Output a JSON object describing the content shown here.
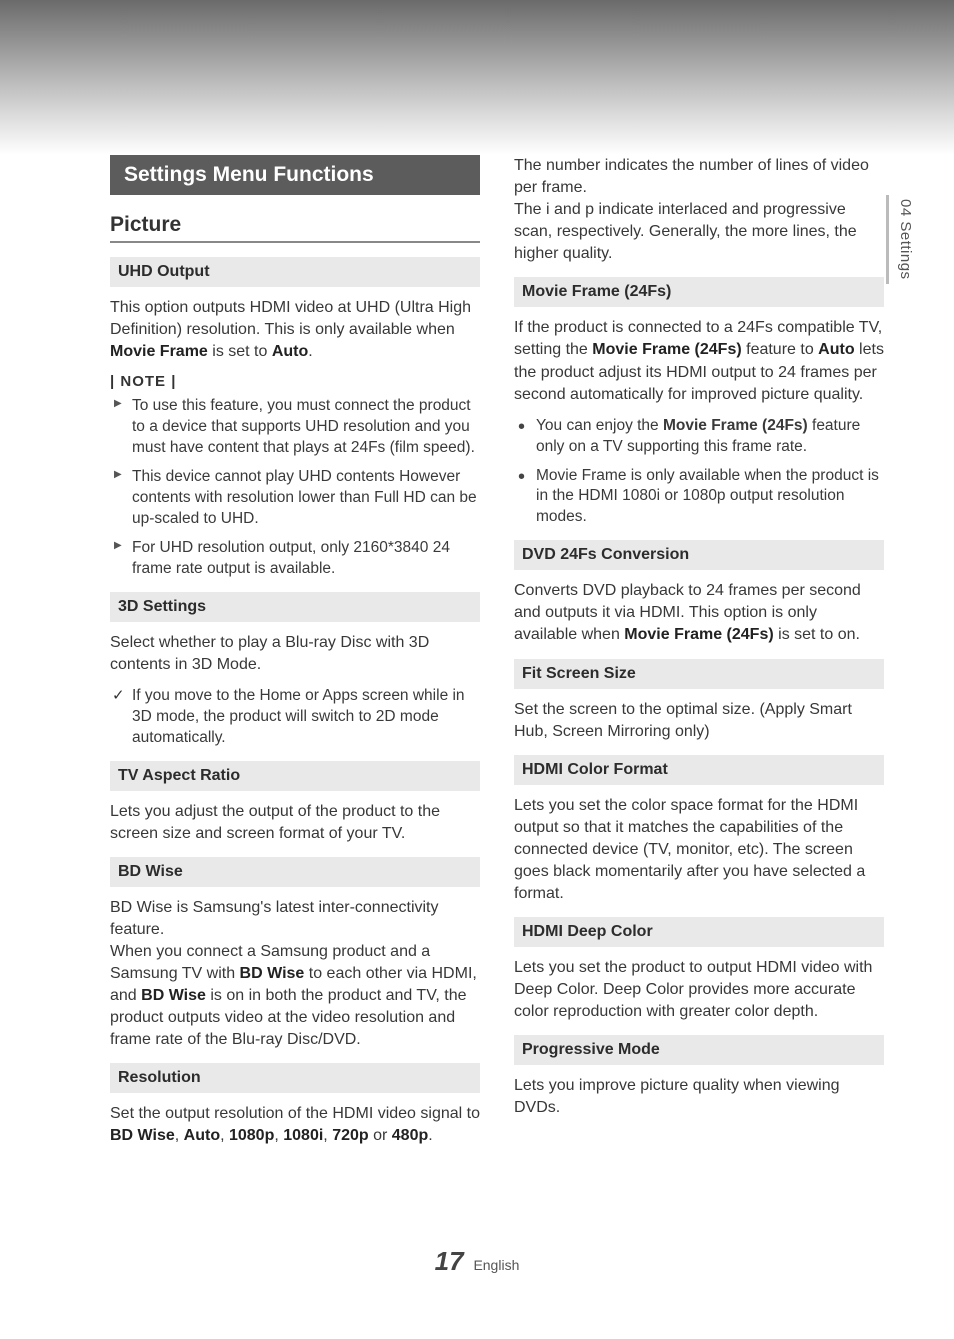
{
  "sideTab": "04  Settings",
  "chapterTitle": "Settings Menu Functions",
  "sectionTitle": "Picture",
  "noteLabel": "| NOTE |",
  "left": {
    "uhd": {
      "head": "UHD Output",
      "p1a": "This option outputs HDMI video at UHD (Ultra High Definition) resolution. This is only available when ",
      "p1b": "Movie Frame",
      "p1c": " is set to ",
      "p1d": "Auto",
      "p1e": ".",
      "n1": "To use this feature, you must connect the product to a device that supports UHD resolution and you must have content that plays at 24Fs (film speed).",
      "n2": "This device cannot play UHD contents However contents with resolution lower than Full HD can be up-scaled to UHD.",
      "n3": "For UHD resolution output, only 2160*3840 24 frame rate output is available."
    },
    "threeD": {
      "head": "3D Settings",
      "p1": "Select whether to play a Blu-ray Disc with 3D contents in 3D Mode.",
      "c1": "If you move to the Home or Apps screen while in 3D mode, the product will switch to 2D mode automatically."
    },
    "aspect": {
      "head": "TV Aspect Ratio",
      "p1": "Lets you adjust the output of the product to the screen size and screen format of your TV."
    },
    "bdwise": {
      "head": "BD Wise",
      "p1a": "BD Wise is Samsung's latest inter-connectivity feature.",
      "p1b": "When you connect a Samsung product and a Samsung TV with ",
      "p1c": "BD Wise",
      "p1d": " to each other via HDMI, and ",
      "p1e": "BD Wise",
      "p1f": " is on in both the product and TV, the product outputs video at the video resolution and frame rate of the Blu-ray Disc/DVD."
    },
    "resolution": {
      "head": "Resolution",
      "p1a": "Set the output resolution of the HDMI video signal to ",
      "b1": "BD Wise",
      "s1": ", ",
      "b2": "Auto",
      "s2": ", ",
      "b3": "1080p",
      "s3": ", ",
      "b4": "1080i",
      "s4": ", ",
      "b5": "720p",
      "s5": " or ",
      "b6": "480p",
      "s6": "."
    }
  },
  "right": {
    "resCont": "The number indicates the number of lines of video per frame.\nThe i and p indicate interlaced and progressive scan, respectively. Generally, the more lines, the higher quality.",
    "movieFrame": {
      "head": "Movie Frame (24Fs)",
      "p1a": "If the product is connected to a 24Fs compatible TV, setting the ",
      "p1b": "Movie Frame (24Fs)",
      "p1c": " feature to ",
      "p1d": "Auto",
      "p1e": " lets the product adjust its HDMI output to 24 frames per second automatically for improved picture quality.",
      "l1a": "You can enjoy the ",
      "l1b": "Movie Frame (24Fs)",
      "l1c": " feature only on a TV supporting this frame rate.",
      "l2": "Movie Frame is only available when the product is in the HDMI 1080i or 1080p output resolution modes."
    },
    "dvd24": {
      "head": "DVD 24Fs Conversion",
      "p1a": "Converts DVD playback to 24 frames per second and outputs it via HDMI. This option is only available when ",
      "p1b": "Movie Frame (24Fs)",
      "p1c": " is set to on."
    },
    "fit": {
      "head": "Fit Screen Size",
      "p1": "Set the screen to the optimal size. (Apply Smart Hub, Screen Mirroring only)"
    },
    "hdmiColor": {
      "head": "HDMI Color Format",
      "p1": "Lets you set the color space format for the HDMI output so that it matches the capabilities of the connected device (TV, monitor, etc). The screen goes black momentarily after you have selected a format."
    },
    "hdmiDeep": {
      "head": "HDMI Deep Color",
      "p1": "Lets you set the product to output HDMI video with Deep Color. Deep Color provides more accurate color reproduction with greater color depth."
    },
    "prog": {
      "head": "Progressive Mode",
      "p1": "Lets you improve picture quality when viewing DVDs."
    }
  },
  "footer": {
    "page": "17",
    "lang": "English"
  }
}
